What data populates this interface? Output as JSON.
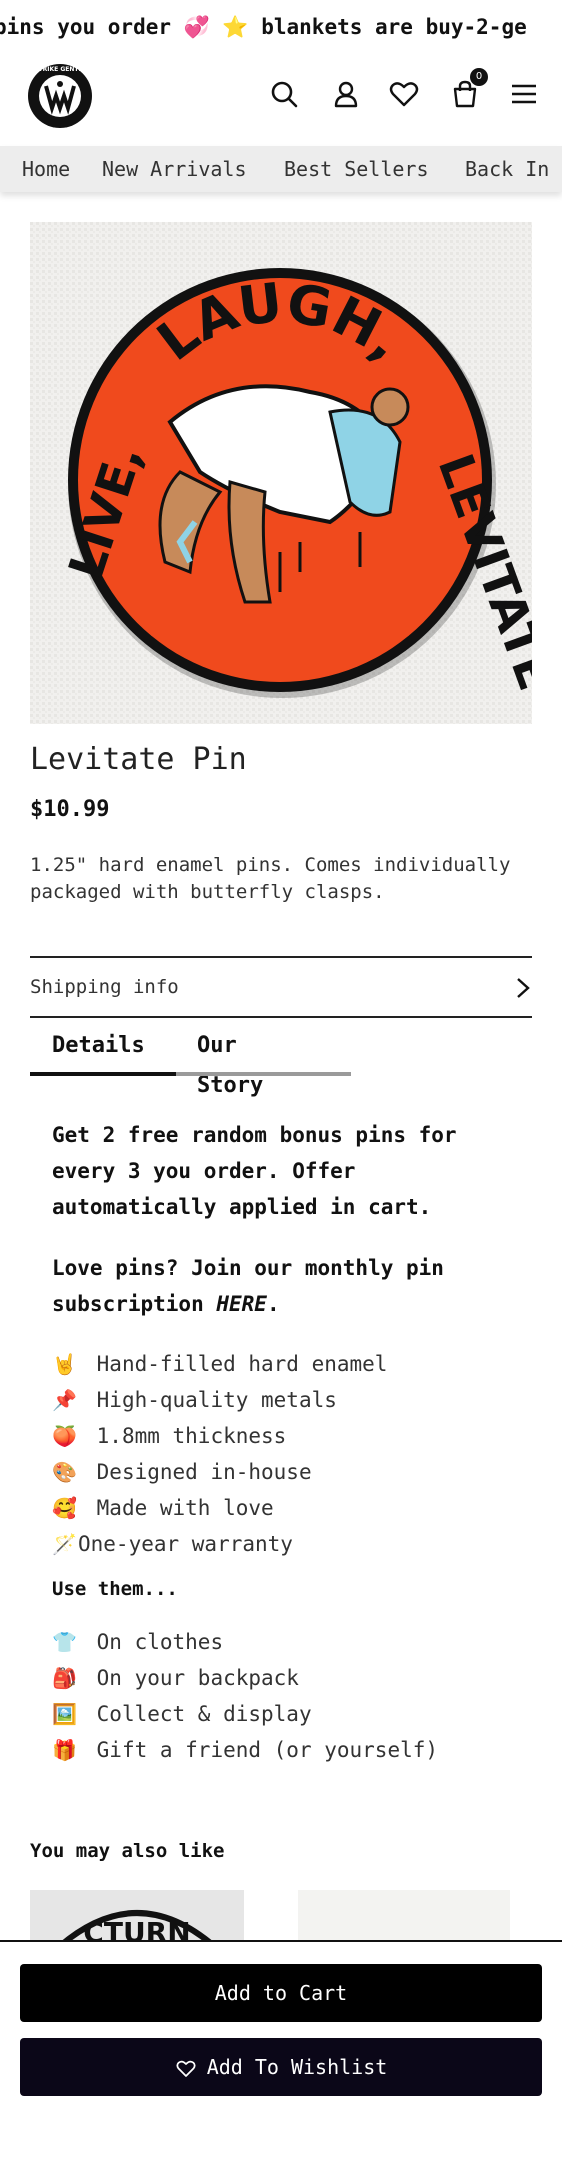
{
  "announcement": "pins you order 💞  ⭐ blankets are buy-2-ge",
  "header": {
    "logo_text": "STRIKE GENTLY",
    "cart_count": "0"
  },
  "nav": {
    "items": [
      "Home",
      "New Arrivals",
      "Best Sellers",
      "Back In"
    ]
  },
  "product": {
    "image_text_top": "LAUGH,",
    "image_text_right": "LEVITATE",
    "image_text_left": "LIVE,",
    "title": "Levitate Pin",
    "price": "$10.99",
    "description": "1.25\" hard enamel pins. Comes individually packaged with butterfly clasps."
  },
  "shipping": {
    "label": "Shipping info"
  },
  "tabs": [
    {
      "label": "Details",
      "active": true
    },
    {
      "label": "Our Story",
      "active": false
    }
  ],
  "details": {
    "promo": "Get 2 free random bonus pins for every 3 you order. Offer automatically applied in cart.",
    "subscription_text": "Love pins? Join our monthly pin subscription ",
    "subscription_link": "HERE",
    "subscription_end": ".",
    "features": [
      {
        "icon": "🤘",
        "text": "Hand-filled hard enamel"
      },
      {
        "icon": "📌",
        "text": "High-quality metals"
      },
      {
        "icon": "🍑",
        "text": "1.8mm thickness"
      },
      {
        "icon": "🎨",
        "text": "Designed in-house"
      },
      {
        "icon": "🥰",
        "text": "Made with love"
      },
      {
        "icon": "🪄",
        "text": "One-year warranty"
      }
    ],
    "use_title": "Use them...",
    "uses": [
      {
        "icon": "👕",
        "text": "On clothes"
      },
      {
        "icon": "🎒",
        "text": "On your backpack"
      },
      {
        "icon": "🖼️",
        "text": "Collect & display"
      },
      {
        "icon": "🎁",
        "text": "Gift a friend (or yourself)"
      }
    ]
  },
  "recommendations": {
    "title": "You may also like",
    "item1_image_text": "CTURN"
  },
  "actions": {
    "add_to_cart": "Add to Cart",
    "add_to_wishlist": "Add To Wishlist"
  },
  "colors": {
    "pin_orange": "#f04a1d",
    "button_black": "#000000",
    "wishlist_navy": "#0b0718",
    "tab_active": "#111111",
    "tab_inactive": "#9a9a9a"
  }
}
